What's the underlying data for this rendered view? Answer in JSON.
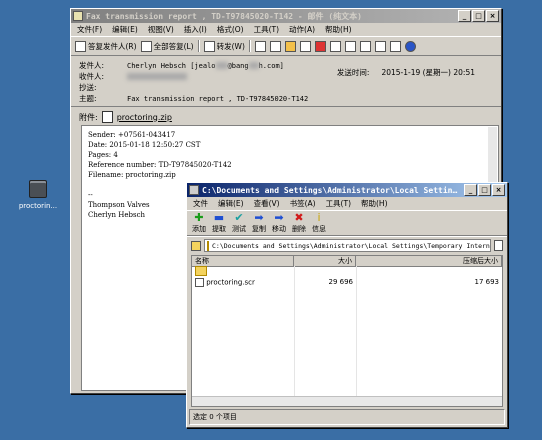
{
  "desktop": {
    "icon_label": "proctorin..."
  },
  "mail": {
    "title": "Fax transmission report , TD-T97845020-T142 - 邮件 (纯文本)",
    "menu": [
      "文件(F)",
      "编辑(E)",
      "视图(V)",
      "插入(I)",
      "格式(O)",
      "工具(T)",
      "动作(A)",
      "帮助(H)"
    ],
    "toolbar": {
      "reply": "答复发件人(R)",
      "reply_all": "全部答复(L)",
      "forward": "转发(W)"
    },
    "headers": {
      "from_label": "发件人:",
      "from_name": "Cherlyn Hebsch [jealo",
      "from_mid": "@bang",
      "from_end": "h.com]",
      "to_label": "收件人:",
      "cc_label": "抄送:",
      "subject_label": "主题:",
      "subject": "Fax transmission report , TD-T97845020-T142",
      "sent_label": "发送时间:",
      "sent_value": "2015-1-19 (星期一) 20:51",
      "attach_label": "附件:",
      "attachment": "proctoring.zip"
    },
    "body_lines": [
      "Sender: +07561-043417",
      "Date: 2015-01-18 12:50:27 CST",
      "Pages: 4",
      "Reference number: TD-T97845020-T142",
      "Filename: proctoring.zip",
      "",
      "--",
      "Thompson Valves",
      "Cherlyn Hebsch"
    ]
  },
  "explorer": {
    "title": "C:\\Documents and Settings\\Administrator\\Local Settings\\Tempor...",
    "menu": [
      "文件",
      "编辑(E)",
      "查看(V)",
      "书签(A)",
      "工具(T)",
      "帮助(H)"
    ],
    "tools": [
      {
        "label": "添加",
        "icon": "add-icon",
        "glyph": "✚",
        "color": "#1a9c1a"
      },
      {
        "label": "提取",
        "icon": "extract-icon",
        "glyph": "▬",
        "color": "#1f4fd1"
      },
      {
        "label": "测试",
        "icon": "test-icon",
        "glyph": "✔",
        "color": "#1aa0a0"
      },
      {
        "label": "复制",
        "icon": "copy-icon",
        "glyph": "➡",
        "color": "#1f4fd1"
      },
      {
        "label": "移动",
        "icon": "move-icon",
        "glyph": "➡",
        "color": "#1f4fd1"
      },
      {
        "label": "删除",
        "icon": "delete-icon",
        "glyph": "✖",
        "color": "#d11a1a"
      },
      {
        "label": "信息",
        "icon": "info-icon",
        "glyph": "i",
        "color": "#c9a400"
      }
    ],
    "address": "C:\\Documents and Settings\\Administrator\\Local Settings\\Temporary Internet F",
    "columns": {
      "name": "名称",
      "size": "大小",
      "packed": "压缩后大小"
    },
    "rows": [
      {
        "name": "..",
        "size": "",
        "packed": ""
      },
      {
        "name": "proctoring.scr",
        "size": "29 696",
        "packed": "17 693"
      }
    ],
    "status": "选定 0 个项目"
  }
}
